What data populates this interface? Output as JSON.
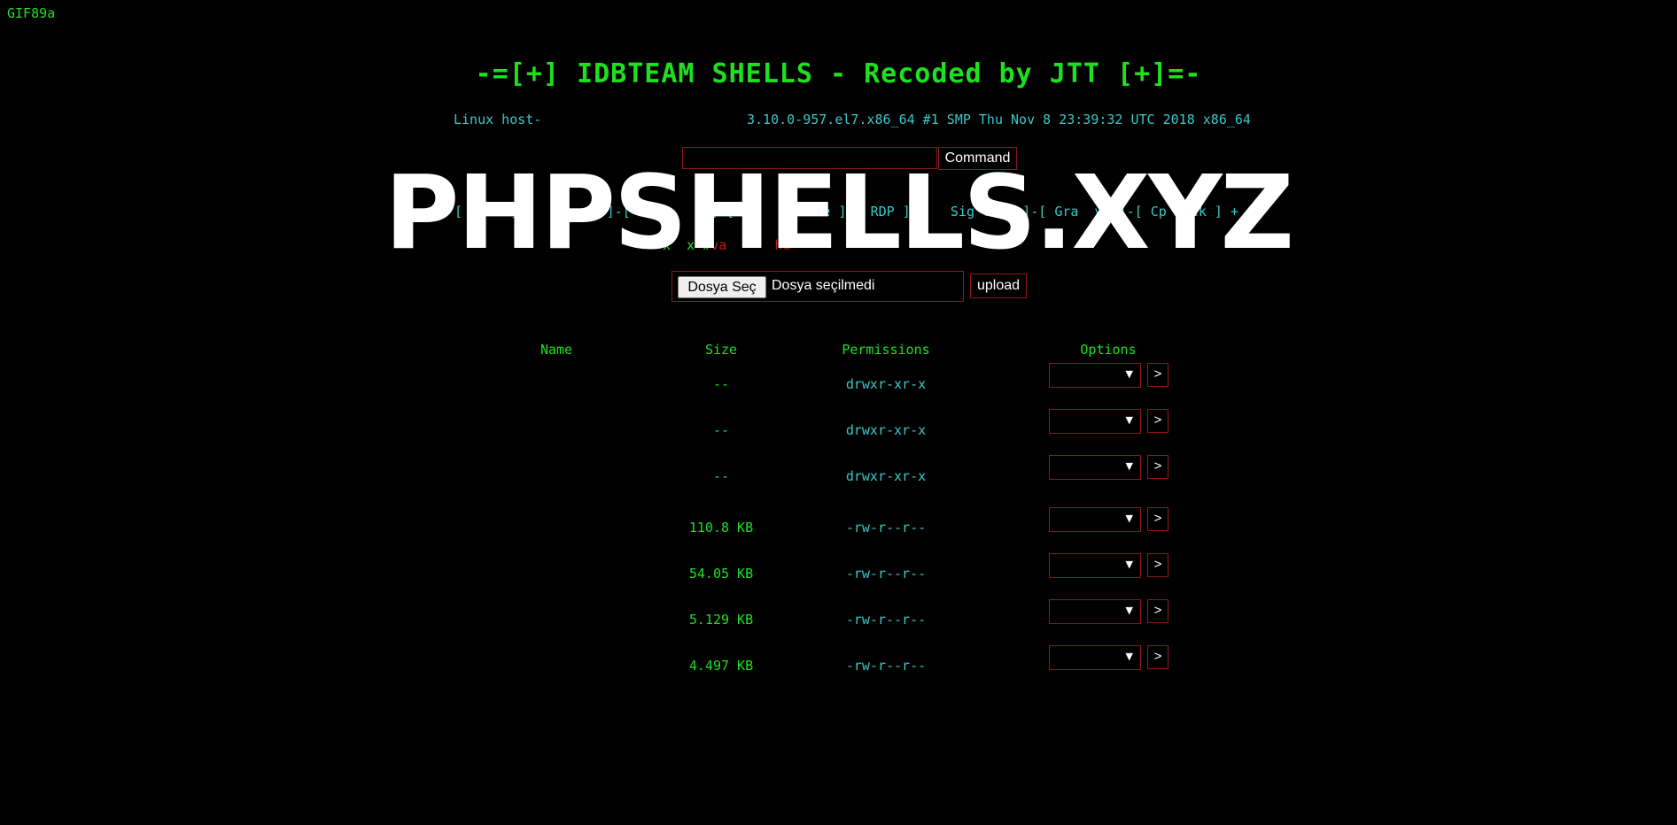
{
  "header": {
    "gif_marker": "GIF89a",
    "title": "-=[+] IDBTEAM SHELLS - Recoded by JTT [+]=-",
    "uname_left": "Linux host-",
    "uname_right": "3.10.0-957.el7.x86_64 #1 SMP Thu Nov 8 23:39:32 UTC 2018 x86_64"
  },
  "command": {
    "input_value": "",
    "button_label": "Command"
  },
  "menu": {
    "text": "+ [      ]-[   Mass  ]-[ Jum      ]-[ M    Defa e ]-[ RDP ]-[   Sig Grab ]-[ Gra  v2 ]-[ Cp Krek ] +"
  },
  "info": {
    "green_part": "x  x #",
    "red_part": "va      he"
  },
  "watermark": {
    "text": "PHPSHELLS.XYZ"
  },
  "upload": {
    "choose_label": "Dosya Seç",
    "status_text": "Dosya seçilmedi",
    "button_label": "upload"
  },
  "table": {
    "headers": {
      "name": "Name",
      "size": "Size",
      "permissions": "Permissions",
      "options": "Options"
    },
    "rows": [
      {
        "name": "",
        "size": "--",
        "permissions": "drwxr-xr-x",
        "option": "",
        "go": ">"
      },
      {
        "name": "",
        "size": "--",
        "permissions": "drwxr-xr-x",
        "option": "",
        "go": ">"
      },
      {
        "name": "",
        "size": "--",
        "permissions": "drwxr-xr-x",
        "option": "",
        "go": ">"
      },
      {
        "name": "",
        "size": "110.8 KB",
        "permissions": "-rw-r--r--",
        "option": "",
        "go": ">"
      },
      {
        "name": "",
        "size": "54.05 KB",
        "permissions": "-rw-r--r--",
        "option": "",
        "go": ">"
      },
      {
        "name": "",
        "size": "5.129 KB",
        "permissions": "-rw-r--r--",
        "option": "",
        "go": ">"
      },
      {
        "name": "",
        "size": "4.497 KB",
        "permissions": "-rw-r--r--",
        "option": "",
        "go": ">"
      }
    ]
  },
  "icons": {
    "dropdown_arrow": "chevron-down-icon"
  },
  "colors": {
    "background": "#000000",
    "primary_text": "#1fe01f",
    "secondary_text": "#39c8c8",
    "border": "#8b1a1a",
    "warning_text": "#c81e1e"
  }
}
